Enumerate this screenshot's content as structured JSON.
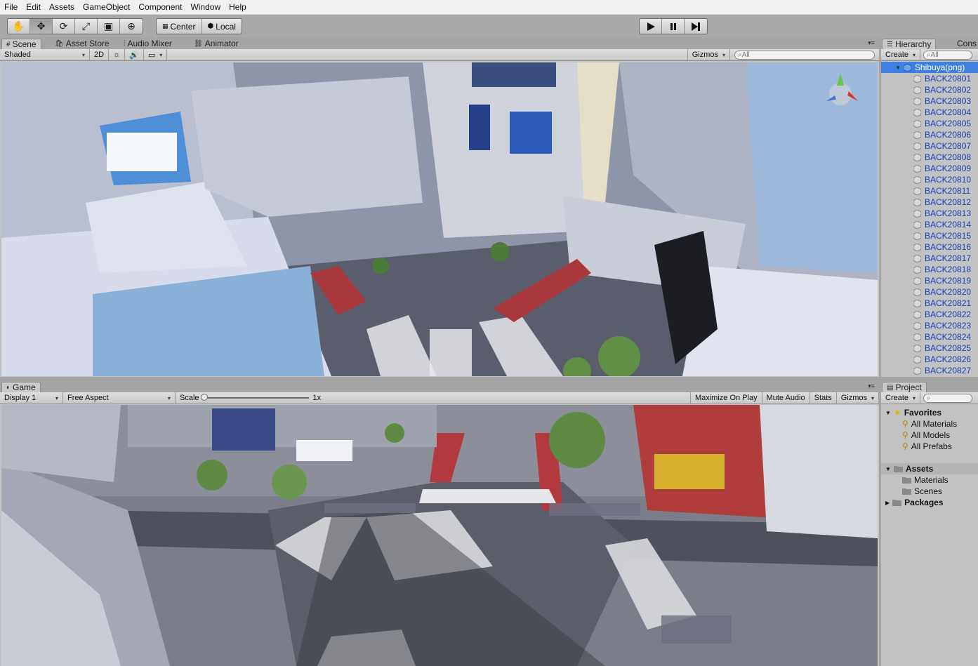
{
  "menu": [
    "File",
    "Edit",
    "Assets",
    "GameObject",
    "Component",
    "Window",
    "Help"
  ],
  "toolbar": {
    "tools": [
      {
        "name": "hand-tool",
        "icon": "hand-icon",
        "glyph": "✋"
      },
      {
        "name": "move-tool",
        "icon": "move-icon",
        "glyph": "✥"
      },
      {
        "name": "rotate-tool",
        "icon": "rotate-icon",
        "glyph": "⟳"
      },
      {
        "name": "scale-tool",
        "icon": "scale-icon",
        "glyph": "⤢"
      },
      {
        "name": "rect-tool",
        "icon": "rect-icon",
        "glyph": "▣"
      },
      {
        "name": "transform-tool",
        "icon": "transform-icon",
        "glyph": "⊕"
      }
    ],
    "active_tool": "move-tool",
    "pivot_label": "Center",
    "space_label": "Local"
  },
  "scene_panel": {
    "tabs": [
      "Scene",
      "Asset Store",
      "Audio Mixer",
      "Animator"
    ],
    "shading": "Shaded",
    "mode_2d": "2D",
    "gizmos": "Gizmos",
    "search_placeholder": "All"
  },
  "hierarchy": {
    "tab": "Hierarchy",
    "second_tab": "Cons",
    "create": "Create",
    "search_placeholder": "All",
    "root": "Shibuya(png)",
    "items": [
      "BACK20801",
      "BACK20802",
      "BACK20803",
      "BACK20804",
      "BACK20805",
      "BACK20806",
      "BACK20807",
      "BACK20808",
      "BACK20809",
      "BACK20810",
      "BACK20811",
      "BACK20812",
      "BACK20813",
      "BACK20814",
      "BACK20815",
      "BACK20816",
      "BACK20817",
      "BACK20818",
      "BACK20819",
      "BACK20820",
      "BACK20821",
      "BACK20822",
      "BACK20823",
      "BACK20824",
      "BACK20825",
      "BACK20826",
      "BACK20827"
    ]
  },
  "game_panel": {
    "tab": "Game",
    "display": "Display 1",
    "aspect": "Free Aspect",
    "scale_label": "Scale",
    "scale_value": "1x",
    "maximize": "Maximize On Play",
    "mute": "Mute Audio",
    "stats": "Stats",
    "gizmos": "Gizmos"
  },
  "project": {
    "tab": "Project",
    "create": "Create",
    "favorites_label": "Favorites",
    "favorites": [
      "All Materials",
      "All Models",
      "All Prefabs"
    ],
    "assets_label": "Assets",
    "assets": [
      "Materials",
      "Scenes"
    ],
    "packages_label": "Packages"
  },
  "colors": {
    "selection": "#3d80df",
    "hierarchy_text": "#1b3fb0",
    "panel_bg": "#c2c2c2"
  }
}
